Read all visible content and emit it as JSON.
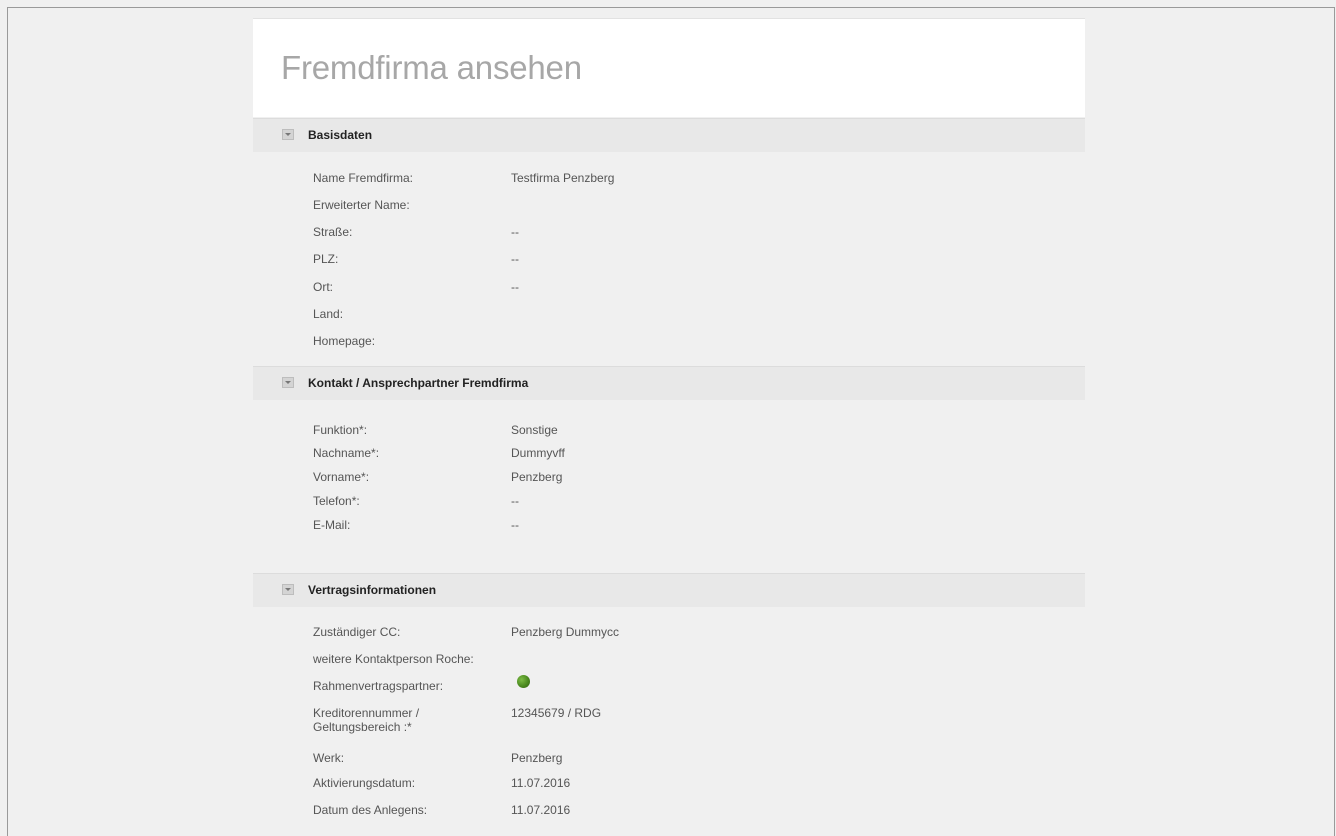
{
  "page": {
    "title": "Fremdfirma ansehen"
  },
  "sections": [
    {
      "label": "Basisdaten",
      "rows": [
        {
          "key": "Name Fremdfirma:",
          "value": "Testfirma Penzberg"
        },
        {
          "key": "Erweiterter Name:",
          "value": ""
        },
        {
          "key": "Straße:",
          "value": "--"
        },
        {
          "key": "PLZ:",
          "value": "--"
        },
        {
          "key": "Ort:",
          "value": "--"
        },
        {
          "key": "Land:",
          "value": ""
        },
        {
          "key": "Homepage:",
          "value": ""
        }
      ]
    },
    {
      "label": "Kontakt / Ansprechpartner Fremdfirma",
      "rows": [
        {
          "key": "Funktion*:",
          "value": "Sonstige"
        },
        {
          "key": "Nachname*:",
          "value": "Dummyvff"
        },
        {
          "key": "Vorname*:",
          "value": "Penzberg"
        },
        {
          "key": "Telefon*:",
          "value": "--"
        },
        {
          "key": "E-Mail:",
          "value": "--"
        }
      ]
    },
    {
      "label": "Vertragsinformationen",
      "rows": [
        {
          "key": "Zuständiger CC:",
          "value": "Penzberg Dummycc"
        },
        {
          "key": "weitere Kontaktperson Roche:",
          "value": ""
        },
        {
          "key": "Rahmenvertragspartner:",
          "value": "",
          "status_color": "#4b8a1f"
        },
        {
          "key": "Kreditorennummer / Geltungsbereich :*",
          "value": "12345679 / RDG"
        },
        {
          "key": "Werk:",
          "value": "Penzberg"
        },
        {
          "key": "Aktivierungsdatum:",
          "value": "11.07.2016"
        },
        {
          "key": "Datum des Anlegens:",
          "value": "11.07.2016"
        }
      ]
    }
  ],
  "icons": {
    "section_toggle": "collapse-triangle-icon",
    "status": "status-dot-icon"
  }
}
